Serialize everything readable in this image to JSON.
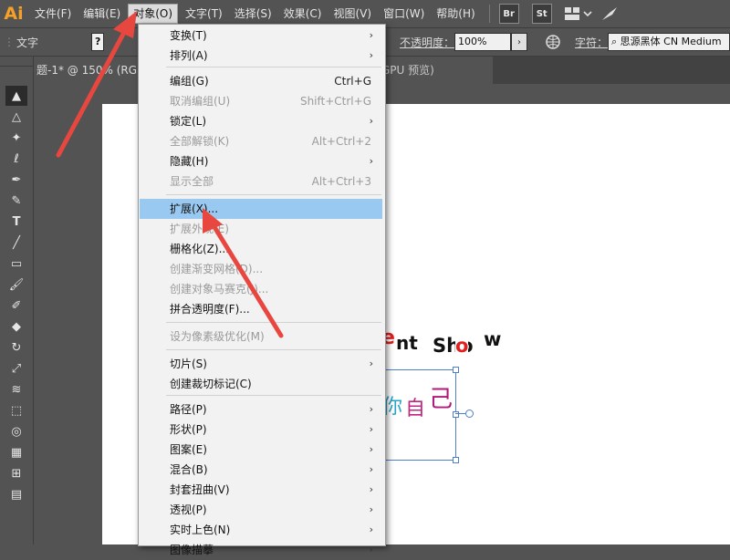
{
  "app": {
    "logo": "Ai"
  },
  "menubar": {
    "items": [
      "文件(F)",
      "编辑(E)",
      "对象(O)",
      "文字(T)",
      "选择(S)",
      "效果(C)",
      "视图(V)",
      "窗口(W)",
      "帮助(H)"
    ],
    "bridge": "Br",
    "stock": "St"
  },
  "controlbar": {
    "mode_label": "文字",
    "question": "?",
    "opacity_label": "不透明度：",
    "opacity_value": "100%",
    "char_label": "字符：",
    "font_value": "思源黑体 CN Medium"
  },
  "tabs": {
    "doc_tab": "题-1* @ 150% (RGB",
    "doc_tab_rest": "GPU 预览)"
  },
  "artwork": {
    "line1_part1": "ent",
    "line1_part2": "Sho",
    "line1_part3": "w",
    "line2_a": "你",
    "line2_b": "自",
    "line2_c": "己"
  },
  "object_menu": {
    "items": [
      {
        "label": "变换(T)",
        "shortcut": "",
        "submenu": true,
        "disabled": false
      },
      {
        "label": "排列(A)",
        "shortcut": "",
        "submenu": true,
        "disabled": false
      },
      {
        "label": "编组(G)",
        "shortcut": "Ctrl+G",
        "submenu": false,
        "disabled": false
      },
      {
        "label": "取消编组(U)",
        "shortcut": "Shift+Ctrl+G",
        "submenu": false,
        "disabled": true
      },
      {
        "label": "锁定(L)",
        "shortcut": "",
        "submenu": true,
        "disabled": false
      },
      {
        "label": "全部解锁(K)",
        "shortcut": "Alt+Ctrl+2",
        "submenu": false,
        "disabled": true
      },
      {
        "label": "隐藏(H)",
        "shortcut": "",
        "submenu": true,
        "disabled": false
      },
      {
        "label": "显示全部",
        "shortcut": "Alt+Ctrl+3",
        "submenu": false,
        "disabled": true
      },
      {
        "label": "扩展(X)...",
        "shortcut": "",
        "submenu": false,
        "disabled": false
      },
      {
        "label": "扩展外观(E)",
        "shortcut": "",
        "submenu": false,
        "disabled": true
      },
      {
        "label": "栅格化(Z)...",
        "shortcut": "",
        "submenu": false,
        "disabled": false
      },
      {
        "label": "创建渐变网格(D)...",
        "shortcut": "",
        "submenu": false,
        "disabled": true
      },
      {
        "label": "创建对象马赛克(J)...",
        "shortcut": "",
        "submenu": false,
        "disabled": true
      },
      {
        "label": "拼合透明度(F)...",
        "shortcut": "",
        "submenu": false,
        "disabled": false
      },
      {
        "label": "设为像素级优化(M)",
        "shortcut": "",
        "submenu": false,
        "disabled": true
      },
      {
        "label": "切片(S)",
        "shortcut": "",
        "submenu": true,
        "disabled": false
      },
      {
        "label": "创建裁切标记(C)",
        "shortcut": "",
        "submenu": false,
        "disabled": false
      },
      {
        "label": "路径(P)",
        "shortcut": "",
        "submenu": true,
        "disabled": false
      },
      {
        "label": "形状(P)",
        "shortcut": "",
        "submenu": true,
        "disabled": false
      },
      {
        "label": "图案(E)",
        "shortcut": "",
        "submenu": true,
        "disabled": false
      },
      {
        "label": "混合(B)",
        "shortcut": "",
        "submenu": true,
        "disabled": false
      },
      {
        "label": "封套扭曲(V)",
        "shortcut": "",
        "submenu": true,
        "disabled": false
      },
      {
        "label": "透视(P)",
        "shortcut": "",
        "submenu": true,
        "disabled": false
      },
      {
        "label": "实时上色(N)",
        "shortcut": "",
        "submenu": true,
        "disabled": false
      },
      {
        "label": "图像描摹",
        "shortcut": "",
        "submenu": true,
        "disabled": false
      }
    ],
    "highlighted_index": 8
  },
  "colors": {
    "accent_orange": "#f7a028",
    "menu_highlight": "#99c9f0",
    "annotation_red": "#e8473f"
  }
}
